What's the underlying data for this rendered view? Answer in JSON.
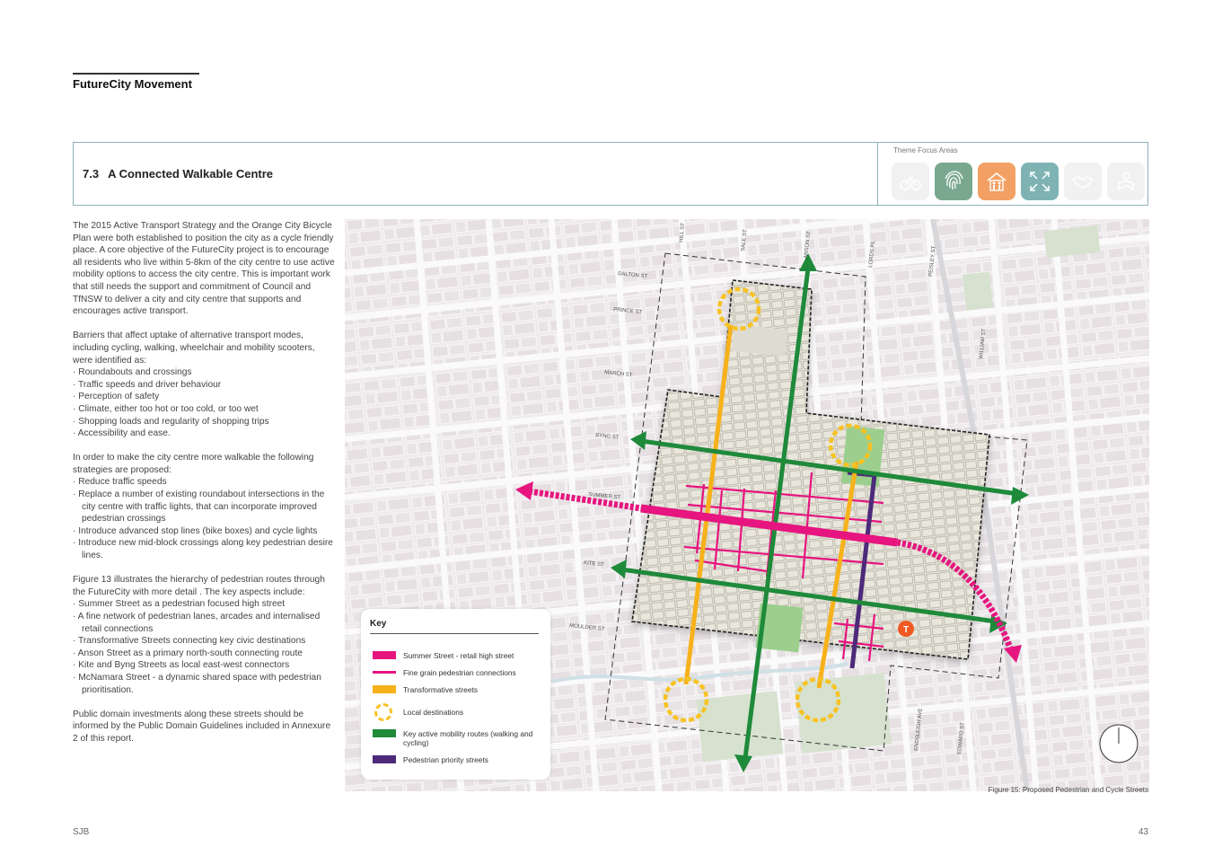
{
  "header": {
    "title": "FutureCity Movement"
  },
  "section": {
    "number": "7.3",
    "title": "A Connected Walkable Centre"
  },
  "theme": {
    "label": "Theme Focus Areas",
    "icons": [
      {
        "name": "bicycle-icon",
        "color": "#f1f1f1",
        "active": false
      },
      {
        "name": "fingerprint-icon",
        "color": "#7aa88f",
        "active": true
      },
      {
        "name": "family-house-icon",
        "color": "#f3a064",
        "active": true
      },
      {
        "name": "expand-arrows-icon",
        "color": "#7fb3b3",
        "active": true
      },
      {
        "name": "handshake-icon",
        "color": "#f1f1f1",
        "active": false
      },
      {
        "name": "person-reading-icon",
        "color": "#f1f1f1",
        "active": false
      }
    ]
  },
  "body": {
    "p1": "The 2015 Active Transport Strategy and the Orange City Bicycle Plan were both established to position the city as a cycle friendly place. A core objective of the FutureCity project is to encourage all residents who live within 5-8km of the city centre to use active mobility options to access the city centre. This is important work that still needs the support and commitment of Council and TfNSW to deliver a city and city centre that supports and encourages active transport.",
    "p2": "Barriers that affect uptake of alternative transport modes, including cycling, walking, wheelchair and mobility scooters, were identified as:",
    "barriers": [
      "Roundabouts and crossings",
      "Traffic speeds and driver behaviour",
      "Perception of safety",
      "Climate, either too hot or too cold, or too wet",
      "Shopping loads and regularity of shopping trips",
      "Accessibility and ease."
    ],
    "p3": "In order to make the city centre more walkable the following strategies are proposed:",
    "strategies": [
      "Reduce traffic speeds",
      "Replace a number of existing roundabout intersections in the city centre with traffic lights, that can incorporate improved pedestrian crossings",
      "Introduce advanced stop lines (bike boxes) and cycle lights",
      "Introduce new mid-block crossings along key pedestrian desire lines."
    ],
    "p4": "Figure 13 illustrates the hierarchy of pedestrian routes through the FutureCity with more detail . The key aspects include:",
    "aspects": [
      "Summer Street as a pedestrian focused high street",
      "A fine network of pedestrian lanes, arcades and internalised retail connections",
      "Transformative Streets connecting key civic destinations",
      "Anson Street as a primary north-south connecting route",
      "Kite and Byng Streets as local east-west connectors",
      "McNamara Street - a dynamic shared space with pedestrian prioritisation."
    ],
    "p5": "Public domain investments along these streets should be informed by the Public Domain Guidelines included in Annexure 2 of this report."
  },
  "map": {
    "streets": {
      "hill": "HILL ST",
      "sale": "SALE ST",
      "anson": "ANSON ST",
      "lords": "LORDS PL",
      "peisley": "PEISLEY ST",
      "william": "WILLIAM ST",
      "dalton": "DALTON ST",
      "prince": "PRINCE ST",
      "march": "MARCH ST",
      "byng": "BYNG ST",
      "summer": "SUMMER ST",
      "kite": "KITE ST",
      "moulder": "MOULDER ST",
      "endsleigh": "ENDSLEIGH AVE",
      "edward": "EDWARD ST"
    },
    "station_label": "T",
    "colors": {
      "summer": "#e6157f",
      "fine_grain": "#e6157f",
      "transformative": "#f7b21b",
      "destination": "#f7c324",
      "active_mobility": "#1e8a3a",
      "pedestrian_priority": "#4d2a7a"
    }
  },
  "legend": {
    "title": "Key",
    "items": [
      "Summer Street - retail high street",
      "Fine grain pedestrian connections",
      "Transformative streets",
      "Local destinations",
      "Key active mobility routes (walking and cycling)",
      "Pedestrian priority streets"
    ]
  },
  "caption": "Figure 15: Proposed Pedestrian and Cycle Streets",
  "footer": {
    "left": "SJB",
    "page": "43"
  }
}
